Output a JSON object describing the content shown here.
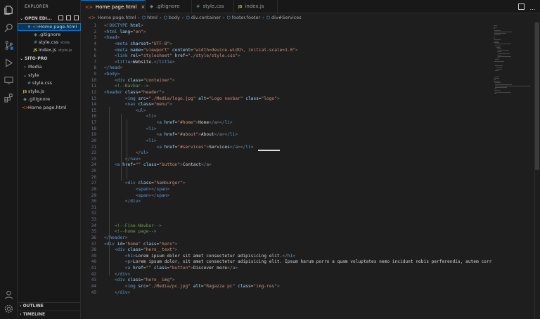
{
  "explorer": {
    "title": "EXPLORER",
    "open_editors_label": "OPEN EDI...",
    "open_editors": [
      {
        "icon": "x",
        "name": "Home page.html",
        "sub": "",
        "type": "html",
        "selected": true
      },
      {
        "icon": "git",
        "name": ".gitignore",
        "sub": "",
        "type": "git",
        "selected": false
      },
      {
        "icon": "css",
        "name": "style.css",
        "sub": "style",
        "type": "css",
        "selected": false
      },
      {
        "icon": "js",
        "name": "index.js",
        "sub": "style.js",
        "type": "js",
        "selected": false
      }
    ],
    "project_label": "SITO-PRO",
    "tree": [
      {
        "name": "Media",
        "type": "folder",
        "depth": 1
      },
      {
        "name": "style",
        "type": "folder-open",
        "depth": 1
      },
      {
        "name": "style.css",
        "type": "css",
        "depth": 2
      },
      {
        "name": "style.js",
        "type": "js",
        "depth": 1
      },
      {
        "name": ".gitignore",
        "type": "git",
        "depth": 1
      },
      {
        "name": "Home page.html",
        "type": "html",
        "depth": 1
      }
    ],
    "outline_label": "OUTLINE",
    "timeline_label": "TIMELINE"
  },
  "tabs": [
    {
      "label": "Home page.html",
      "type": "html",
      "active": true,
      "close": "×"
    },
    {
      "label": ".gitignore",
      "type": "git",
      "active": false,
      "close": ""
    },
    {
      "label": "style.css",
      "type": "css",
      "active": false,
      "close": ""
    },
    {
      "label": "index.js",
      "type": "js",
      "active": false,
      "close": ""
    }
  ],
  "breadcrumb": [
    "Home page.html",
    "html",
    "body",
    "div.container",
    "footer.footer",
    "div#Services"
  ],
  "editor": {
    "line_numbers": [
      "1",
      "2",
      "3",
      "4",
      "5",
      "6",
      "7",
      "8",
      "9",
      "10",
      "11",
      "12",
      "13",
      "14",
      "15",
      "16",
      "17",
      "18",
      "19",
      "20",
      "21",
      "22",
      "23",
      "24",
      "25",
      "26",
      "27",
      "28",
      "29",
      "30",
      "31",
      "32",
      "33",
      "34",
      "35",
      "36",
      "37",
      "38",
      "39",
      "40",
      "41",
      "42",
      "43",
      "44",
      "45"
    ],
    "lines": [
      [
        [
          "<!",
          "t-pun"
        ],
        [
          "DOCTYPE",
          "t-tag"
        ],
        [
          " html",
          "t-attr"
        ],
        [
          ">",
          "t-pun"
        ]
      ],
      [
        [
          "<",
          "t-pun"
        ],
        [
          "html",
          "t-tag"
        ],
        [
          " lang",
          "t-attr"
        ],
        [
          "=",
          "t-txt"
        ],
        [
          "\"en\"",
          "t-str"
        ],
        [
          ">",
          "t-pun"
        ]
      ],
      [
        [
          "<",
          "t-pun"
        ],
        [
          "head",
          "t-tag"
        ],
        [
          ">",
          "t-pun"
        ]
      ],
      [
        [
          "    <",
          "t-pun"
        ],
        [
          "meta",
          "t-tag"
        ],
        [
          " charset",
          "t-attr"
        ],
        [
          "=",
          "t-txt"
        ],
        [
          "\"UTF-8\"",
          "t-str"
        ],
        [
          ">",
          "t-pun"
        ]
      ],
      [
        [
          "    <",
          "t-pun"
        ],
        [
          "meta",
          "t-tag"
        ],
        [
          " name",
          "t-attr"
        ],
        [
          "=",
          "t-txt"
        ],
        [
          "\"viewport\"",
          "t-str"
        ],
        [
          " content",
          "t-attr"
        ],
        [
          "=",
          "t-txt"
        ],
        [
          "\"width=device-width, initial-scale=1.0\"",
          "t-str"
        ],
        [
          ">",
          "t-pun"
        ]
      ],
      [
        [
          "    <",
          "t-pun"
        ],
        [
          "link",
          "t-tag"
        ],
        [
          " rel",
          "t-attr"
        ],
        [
          "=",
          "t-txt"
        ],
        [
          "\"stylesheet\"",
          "t-str"
        ],
        [
          " href",
          "t-attr"
        ],
        [
          "=",
          "t-txt"
        ],
        [
          "\"./style/style.css\"",
          "t-str"
        ],
        [
          ">",
          "t-pun"
        ]
      ],
      [
        [
          "    <",
          "t-pun"
        ],
        [
          "title",
          "t-tag"
        ],
        [
          ">",
          "t-pun"
        ],
        [
          "Website.",
          "t-txt"
        ],
        [
          "</",
          "t-pun"
        ],
        [
          "title",
          "t-tag"
        ],
        [
          ">",
          "t-pun"
        ]
      ],
      [
        [
          "</",
          "t-pun"
        ],
        [
          "head",
          "t-tag"
        ],
        [
          ">",
          "t-pun"
        ]
      ],
      [
        [
          "<",
          "t-pun"
        ],
        [
          "body",
          "t-tag"
        ],
        [
          ">",
          "t-pun"
        ]
      ],
      [
        [
          "    <",
          "t-pun"
        ],
        [
          "div",
          "t-tag"
        ],
        [
          " class",
          "t-attr"
        ],
        [
          "=",
          "t-txt"
        ],
        [
          "\"conteiner\"",
          "t-str"
        ],
        [
          ">",
          "t-pun"
        ]
      ],
      [
        [
          "    ",
          "t-txt"
        ],
        [
          "<!--Navbar-->",
          "t-com"
        ]
      ],
      [
        [
          "<",
          "t-pun"
        ],
        [
          "header",
          "t-tag"
        ],
        [
          " class",
          "t-attr"
        ],
        [
          "=",
          "t-txt"
        ],
        [
          "\"header\"",
          "t-str"
        ],
        [
          ">",
          "t-pun"
        ]
      ],
      [
        [
          "        <",
          "t-pun"
        ],
        [
          "img",
          "t-tag"
        ],
        [
          " src",
          "t-attr"
        ],
        [
          "=",
          "t-txt"
        ],
        [
          "\"./Media/logo.jpg\"",
          "t-str"
        ],
        [
          " alt",
          "t-attr"
        ],
        [
          "=",
          "t-txt"
        ],
        [
          "\"Logo navbar\"",
          "t-str"
        ],
        [
          " class",
          "t-attr"
        ],
        [
          "=",
          "t-txt"
        ],
        [
          "\"logo\"",
          "t-str"
        ],
        [
          ">",
          "t-pun"
        ]
      ],
      [
        [
          "        <",
          "t-pun"
        ],
        [
          "nav",
          "t-tag"
        ],
        [
          " class",
          "t-attr"
        ],
        [
          "=",
          "t-txt"
        ],
        [
          "\"menu\"",
          "t-str"
        ],
        [
          ">",
          "t-pun"
        ]
      ],
      [
        [
          "            <",
          "t-pun"
        ],
        [
          "ul",
          "t-tag"
        ],
        [
          ">",
          "t-pun"
        ]
      ],
      [
        [
          "                <",
          "t-pun"
        ],
        [
          "li",
          "t-tag"
        ],
        [
          ">",
          "t-pun"
        ]
      ],
      [
        [
          "                    <",
          "t-pun"
        ],
        [
          "a",
          "t-tag"
        ],
        [
          " href",
          "t-attr"
        ],
        [
          "=",
          "t-txt"
        ],
        [
          "\"#home\"",
          "t-str"
        ],
        [
          ">",
          "t-pun"
        ],
        [
          "Home",
          "t-txt"
        ],
        [
          "</",
          "t-pun"
        ],
        [
          "a",
          "t-tag"
        ],
        [
          "></",
          "t-pun"
        ],
        [
          "li",
          "t-tag"
        ],
        [
          ">",
          "t-pun"
        ]
      ],
      [
        [
          "                <",
          "t-pun"
        ],
        [
          "li",
          "t-tag"
        ],
        [
          ">",
          "t-pun"
        ]
      ],
      [
        [
          "                    <",
          "t-pun"
        ],
        [
          "a",
          "t-tag"
        ],
        [
          " href",
          "t-attr"
        ],
        [
          "=",
          "t-txt"
        ],
        [
          "\"#about\"",
          "t-str"
        ],
        [
          ">",
          "t-pun"
        ],
        [
          "About",
          "t-txt"
        ],
        [
          "</",
          "t-pun"
        ],
        [
          "a",
          "t-tag"
        ],
        [
          "></",
          "t-pun"
        ],
        [
          "li",
          "t-tag"
        ],
        [
          ">",
          "t-pun"
        ]
      ],
      [
        [
          "                <",
          "t-pun"
        ],
        [
          "li",
          "t-tag"
        ],
        [
          ">",
          "t-pun"
        ]
      ],
      [
        [
          "                    <",
          "t-pun"
        ],
        [
          "a",
          "t-tag"
        ],
        [
          " href",
          "t-attr"
        ],
        [
          "=",
          "t-txt"
        ],
        [
          "\"#services\"",
          "t-str"
        ],
        [
          ">",
          "t-pun"
        ],
        [
          "Services",
          "t-txt"
        ],
        [
          "</",
          "t-pun"
        ],
        [
          "a",
          "t-tag"
        ],
        [
          "></",
          "t-pun"
        ],
        [
          "li",
          "t-tag"
        ],
        [
          ">",
          "t-pun"
        ]
      ],
      [
        [
          "            </",
          "t-pun"
        ],
        [
          "ul",
          "t-tag"
        ],
        [
          ">",
          "t-pun"
        ]
      ],
      [
        [
          "        </",
          "t-pun"
        ],
        [
          "nav",
          "t-tag"
        ],
        [
          ">",
          "t-pun"
        ]
      ],
      [
        [
          "    <",
          "t-pun"
        ],
        [
          "a",
          "t-tag"
        ],
        [
          " href",
          "t-attr"
        ],
        [
          "=",
          "t-txt"
        ],
        [
          "\"\"",
          "t-str"
        ],
        [
          " class",
          "t-attr"
        ],
        [
          "=",
          "t-txt"
        ],
        [
          "\"button\"",
          "t-str"
        ],
        [
          ">",
          "t-pun"
        ],
        [
          "Contact",
          "t-txt"
        ],
        [
          "</",
          "t-pun"
        ],
        [
          "a",
          "t-tag"
        ],
        [
          ">",
          "t-pun"
        ]
      ],
      [],
      [],
      [
        [
          "        <",
          "t-pun"
        ],
        [
          "div",
          "t-tag"
        ],
        [
          " class",
          "t-attr"
        ],
        [
          "=",
          "t-txt"
        ],
        [
          "\"hamburger\"",
          "t-str"
        ],
        [
          ">",
          "t-pun"
        ]
      ],
      [
        [
          "            <",
          "t-pun"
        ],
        [
          "span",
          "t-tag"
        ],
        [
          "></",
          "t-pun"
        ],
        [
          "span",
          "t-tag"
        ],
        [
          ">",
          "t-pun"
        ]
      ],
      [
        [
          "            <",
          "t-pun"
        ],
        [
          "span",
          "t-tag"
        ],
        [
          "></",
          "t-pun"
        ],
        [
          "span",
          "t-tag"
        ],
        [
          ">",
          "t-pun"
        ]
      ],
      [
        [
          "        </",
          "t-pun"
        ],
        [
          "div",
          "t-tag"
        ],
        [
          ">",
          "t-pun"
        ]
      ],
      [],
      [],
      [],
      [
        [
          "    ",
          "t-txt"
        ],
        [
          "<!--Fine-Navbar-->",
          "t-com"
        ]
      ],
      [
        [
          "    ",
          "t-txt"
        ],
        [
          "<!--home page-->",
          "t-com"
        ]
      ],
      [
        [
          "</",
          "t-pun"
        ],
        [
          "header",
          "t-tag"
        ],
        [
          ">",
          "t-pun"
        ]
      ],
      [
        [
          "<",
          "t-pun"
        ],
        [
          "div",
          "t-tag"
        ],
        [
          " id",
          "t-attr"
        ],
        [
          "=",
          "t-txt"
        ],
        [
          "\"home\"",
          "t-str"
        ],
        [
          " class",
          "t-attr"
        ],
        [
          "=",
          "t-txt"
        ],
        [
          "\"hero\"",
          "t-str"
        ],
        [
          ">",
          "t-pun"
        ]
      ],
      [
        [
          "    <",
          "t-pun"
        ],
        [
          "div",
          "t-tag"
        ],
        [
          " class",
          "t-attr"
        ],
        [
          "=",
          "t-txt"
        ],
        [
          "\"hero__text\"",
          "t-str"
        ],
        [
          ">",
          "t-pun"
        ]
      ],
      [
        [
          "        <",
          "t-pun"
        ],
        [
          "h1",
          "t-tag"
        ],
        [
          ">",
          "t-pun"
        ],
        [
          "Lorem ipsum dolor sit amet consectetur adipisicing elit.",
          "t-txt"
        ],
        [
          "</",
          "t-pun"
        ],
        [
          "h1",
          "t-tag"
        ],
        [
          ">",
          "t-pun"
        ]
      ],
      [
        [
          "        <",
          "t-pun"
        ],
        [
          "p",
          "t-tag"
        ],
        [
          ">",
          "t-pun"
        ],
        [
          "Lorem ipsum dolor, sit amet consectetur adipisicing elit. Ipsum harum porro a quam voluptates nemo incidunt nobis perferendis, autem corrupti",
          "t-txt"
        ]
      ],
      [
        [
          "        <",
          "t-pun"
        ],
        [
          "a",
          "t-tag"
        ],
        [
          " href",
          "t-attr"
        ],
        [
          "=",
          "t-txt"
        ],
        [
          "\"\"",
          "t-str"
        ],
        [
          " class",
          "t-attr"
        ],
        [
          "=",
          "t-txt"
        ],
        [
          "\"button\"",
          "t-str"
        ],
        [
          ">",
          "t-pun"
        ],
        [
          "Discover more",
          "t-txt"
        ],
        [
          "</",
          "t-pun"
        ],
        [
          "a",
          "t-tag"
        ],
        [
          ">",
          "t-pun"
        ]
      ],
      [
        [
          "    </",
          "t-pun"
        ],
        [
          "div",
          "t-tag"
        ],
        [
          ">",
          "t-pun"
        ]
      ],
      [
        [
          "    <",
          "t-pun"
        ],
        [
          "div",
          "t-tag"
        ],
        [
          " class",
          "t-attr"
        ],
        [
          "=",
          "t-txt"
        ],
        [
          "\"hero__img\"",
          "t-str"
        ],
        [
          ">",
          "t-pun"
        ]
      ],
      [
        [
          "        <",
          "t-pun"
        ],
        [
          "img",
          "t-tag"
        ],
        [
          " src",
          "t-attr"
        ],
        [
          "=",
          "t-txt"
        ],
        [
          "\"./Media/pc.jpg\"",
          "t-str"
        ],
        [
          " alt",
          "t-attr"
        ],
        [
          "=",
          "t-txt"
        ],
        [
          "\"Ragazza pc\"",
          "t-str"
        ],
        [
          " class",
          "t-attr"
        ],
        [
          "=",
          "t-txt"
        ],
        [
          "\"img-res\"",
          "t-str"
        ],
        [
          ">",
          "t-pun"
        ]
      ],
      [
        [
          "    </",
          "t-pun"
        ],
        [
          "div",
          "t-tag"
        ],
        [
          ">",
          "t-pun"
        ]
      ]
    ]
  }
}
